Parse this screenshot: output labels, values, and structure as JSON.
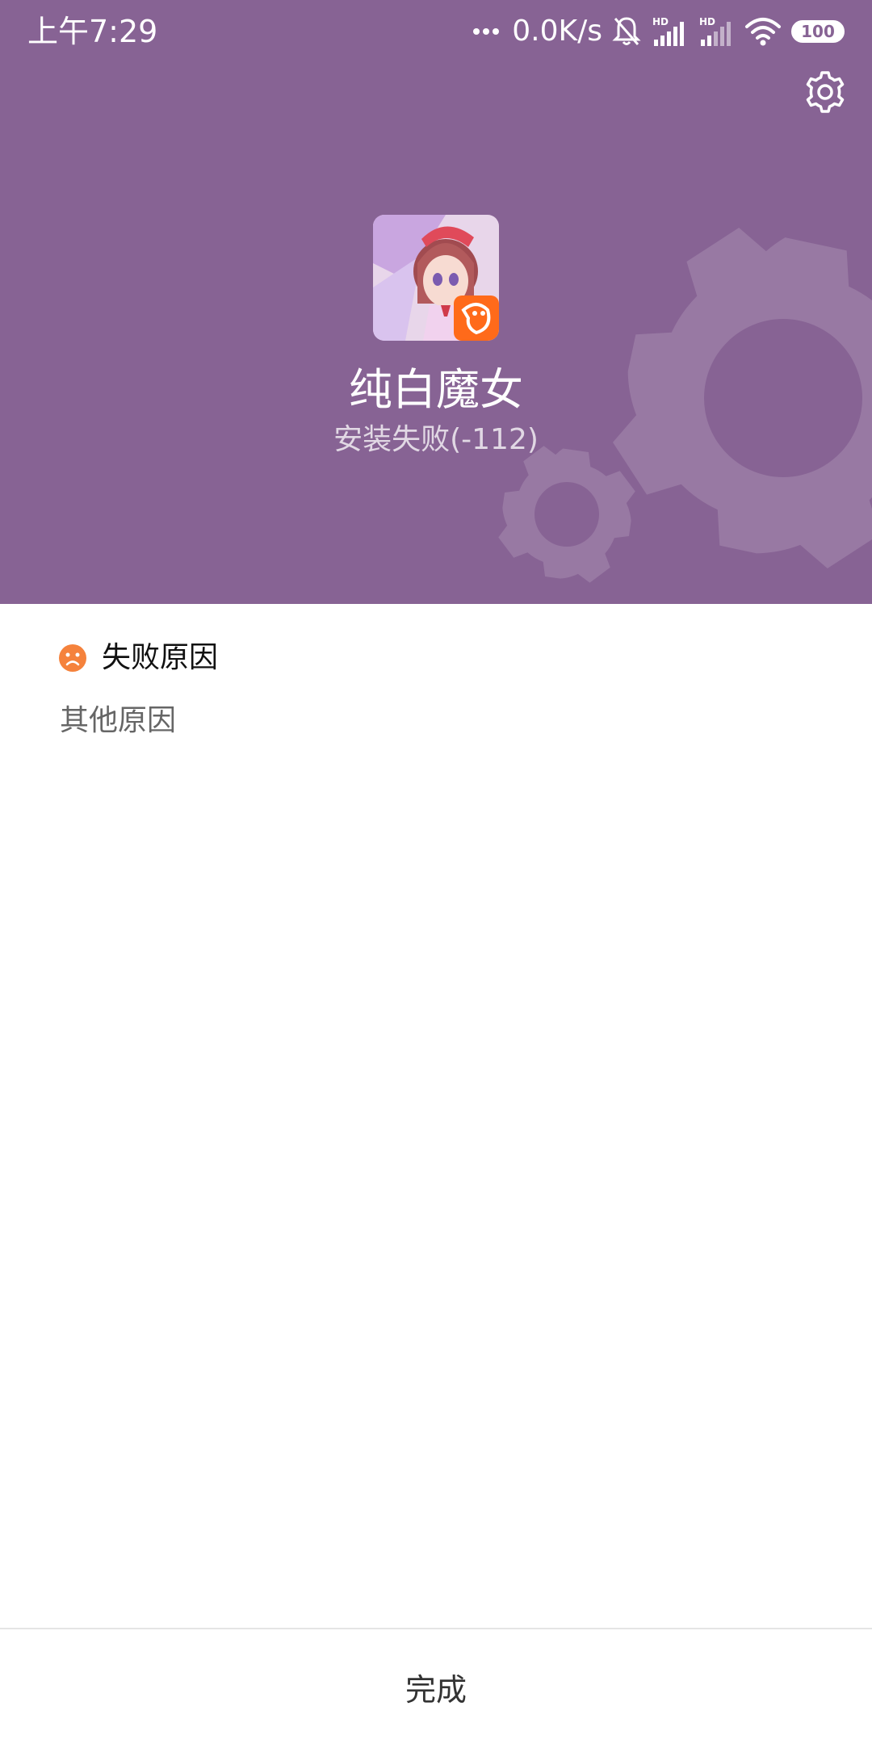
{
  "status_bar": {
    "time": "上午7:29",
    "net_speed": "0.0K/s",
    "network_badges": [
      "HD",
      "HD"
    ],
    "battery": "100",
    "icons": [
      "more-dots-icon",
      "mute-bell-icon",
      "signal-icon",
      "signal-icon",
      "wifi-icon",
      "battery-icon"
    ]
  },
  "header": {
    "settings_icon": "gear-icon",
    "app_icon": "app-icon-anime-girl",
    "app_name": "纯白魔女",
    "install_status": "安装失败(-112)",
    "background_color": "#876394"
  },
  "failure": {
    "icon": "sad-face-icon",
    "title": "失败原因",
    "reason": "其他原因",
    "icon_color": "#F5823C"
  },
  "footer": {
    "done_label": "完成"
  }
}
